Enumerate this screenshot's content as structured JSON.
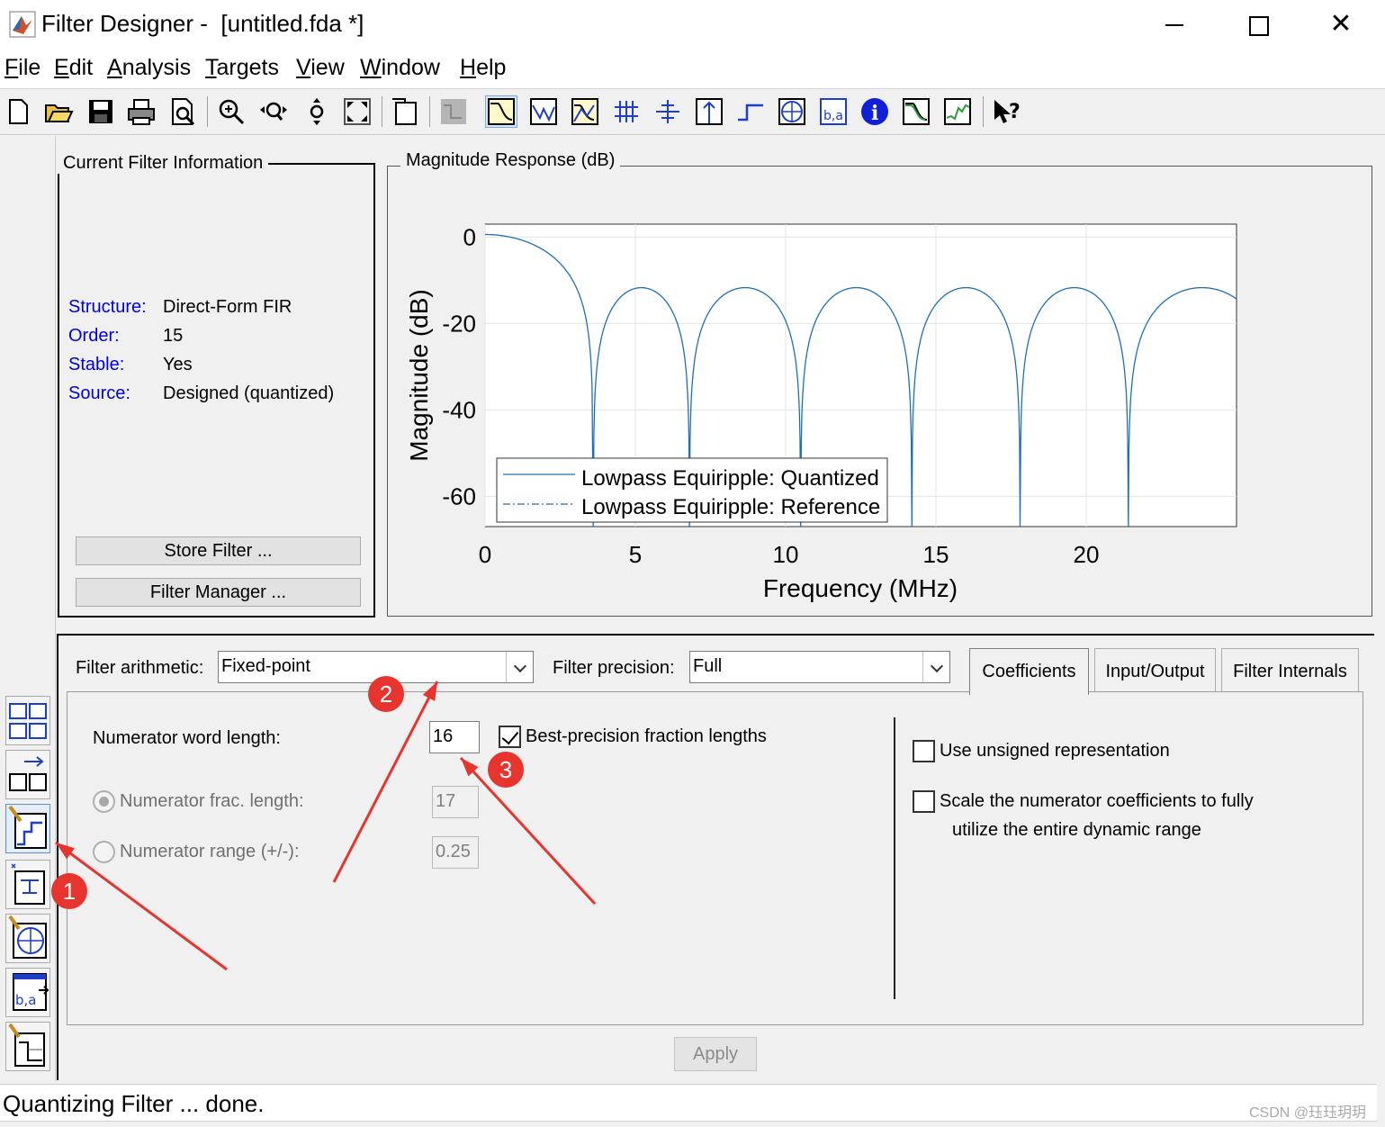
{
  "window": {
    "title": "Filter Designer -  [untitled.fda *]",
    "minimize": "minimize",
    "maximize": "maximize",
    "close": "✕"
  },
  "menu": [
    "File",
    "Edit",
    "Analysis",
    "Targets",
    "View",
    "Window",
    "Help"
  ],
  "toolbar": {
    "icons": [
      "new-icon",
      "open-icon",
      "save-icon",
      "print-icon",
      "print-preview-icon",
      "zoom-in-icon",
      "zoom-x-icon",
      "zoom-y-icon",
      "full-view-icon",
      "new-figure-icon",
      "design-filter-icon",
      "magnitude-response-icon",
      "phase-response-icon",
      "magnitude-phase-icon",
      "group-delay-icon",
      "phase-delay-icon",
      "impulse-response-icon",
      "step-response-icon",
      "pole-zero-icon",
      "coefficients-icon",
      "filter-info-icon",
      "magnitude-estimate-icon",
      "round-off-noise-icon",
      "whats-this-icon"
    ],
    "active": "magnitude-response-icon"
  },
  "sidebar": {
    "icons": [
      "transform-filter-icon",
      "create-multirate-icon",
      "set-quantization-icon",
      "realize-model-icon",
      "pole-zero-editor-icon",
      "import-filter-icon",
      "design-filter-icon"
    ],
    "active": "set-quantization-icon"
  },
  "filter_info": {
    "group_title": "Current Filter Information",
    "rows": [
      {
        "key": "Structure:",
        "value": "Direct-Form FIR"
      },
      {
        "key": "Order:",
        "value": "15"
      },
      {
        "key": "Stable:",
        "value": "Yes"
      },
      {
        "key": "Source:",
        "value": "Designed (quantized)"
      }
    ],
    "store_filter": "Store Filter ...",
    "filter_manager": "Filter Manager ..."
  },
  "plot": {
    "group_title": "Magnitude Response (dB)",
    "xlabel": "Frequency (MHz)",
    "ylabel": "Magnitude (dB)",
    "xticks": [
      "0",
      "5",
      "10",
      "15",
      "20"
    ],
    "yticks": [
      "0",
      "-20",
      "-40",
      "-60"
    ],
    "legend": [
      "Lowpass Equiripple: Quantized",
      "Lowpass Equiripple: Reference"
    ],
    "line_color": "#1f6fb4"
  },
  "chart_data": {
    "type": "line",
    "xlabel": "Frequency (MHz)",
    "ylabel": "Magnitude (dB)",
    "xlim": [
      0,
      25
    ],
    "ylim": [
      -67,
      3
    ],
    "grid": true,
    "legend_position": "bottom-left",
    "passband_edge_mhz": 3.6,
    "sidelobe_level_db": -11.7,
    "nulls_mhz": [
      3.6,
      6.8,
      10.5,
      14.2,
      17.8,
      21.4
    ],
    "sidelobe_peaks_mhz": [
      5.0,
      8.7,
      12.4,
      16.1,
      19.7,
      23.3
    ],
    "series": [
      {
        "name": "Lowpass Equiripple: Quantized",
        "style": "solid"
      },
      {
        "name": "Lowpass Equiripple: Reference",
        "style": "dash-dot"
      }
    ]
  },
  "quant": {
    "arithmetic_label": "Filter arithmetic:",
    "arithmetic_value": "Fixed-point",
    "precision_label": "Filter precision:",
    "precision_value": "Full",
    "tabs": [
      "Coefficients",
      "Input/Output",
      "Filter Internals"
    ],
    "active_tab": "Coefficients",
    "num_word_length_label": "Numerator word length:",
    "num_word_length": "16",
    "best_precision_label": "Best-precision fraction lengths",
    "best_precision_checked": true,
    "num_frac_label": "Numerator frac. length:",
    "num_frac_value": "17",
    "num_range_label": "Numerator range (+/-):",
    "num_range_value": "0.25",
    "unsigned_label": "Use unsigned representation",
    "scale_label_1": "Scale the numerator coefficients to fully",
    "scale_label_2": "utilize the entire dynamic range",
    "apply": "Apply"
  },
  "status": "Quantizing Filter ... done.",
  "watermark": "CSDN @珏珏玥玥",
  "annotations": [
    "1",
    "2",
    "3"
  ],
  "annotation_color": "#e8342e"
}
